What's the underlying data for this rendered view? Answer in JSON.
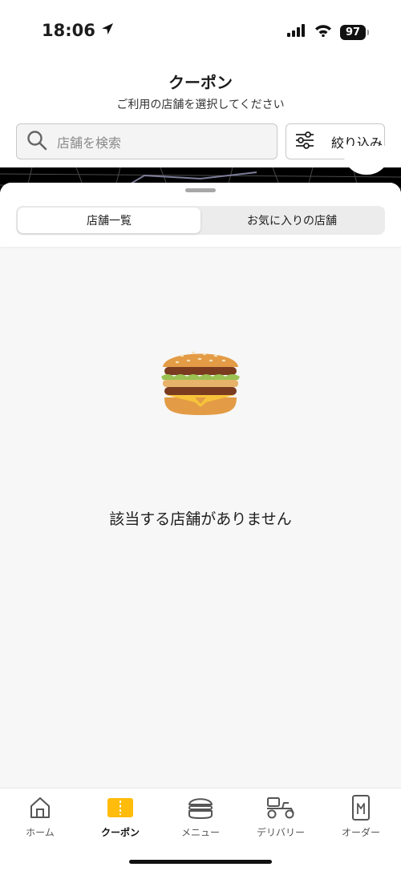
{
  "status_bar": {
    "time": "18:06",
    "battery": "97",
    "icons": [
      "location-arrow-icon",
      "signal-icon",
      "wifi-icon",
      "battery-icon"
    ]
  },
  "header": {
    "title": "クーポン",
    "subtitle": "ご利用の店舗を選択してください"
  },
  "search": {
    "placeholder": "店舗を検索"
  },
  "filter": {
    "label": "絞り込み"
  },
  "segments": [
    {
      "label": "店舗一覧",
      "selected": true
    },
    {
      "label": "お気に入りの店舗",
      "selected": false
    }
  ],
  "empty_state": {
    "icon": "burger-icon",
    "message": "該当する店舗がありません"
  },
  "tab_bar": {
    "items": [
      {
        "label": "ホーム",
        "icon": "home-icon",
        "active": false
      },
      {
        "label": "クーポン",
        "icon": "coupon-icon",
        "active": true
      },
      {
        "label": "メニュー",
        "icon": "burger-outline-icon",
        "active": false
      },
      {
        "label": "デリバリー",
        "icon": "delivery-scooter-icon",
        "active": false
      },
      {
        "label": "オーダー",
        "icon": "mobile-order-icon",
        "active": false
      }
    ]
  },
  "colors": {
    "accent": "#FFBC0D",
    "text": "#1D1D1D",
    "sheet_background": "#F7F7F7"
  }
}
